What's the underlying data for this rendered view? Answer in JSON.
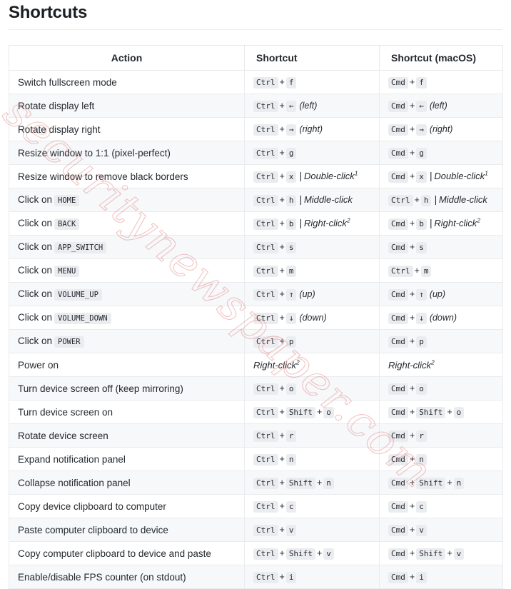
{
  "page": {
    "title": "Shortcuts",
    "watermark": "securitynewspaper.com",
    "watermark_color": "#e28282",
    "kbd_background": "#eaecef",
    "row_alt_background": "#f6f8fa",
    "border_color": "#e6e8eb"
  },
  "table": {
    "headers": {
      "action": "Action",
      "shortcut": "Shortcut",
      "shortcut_macos": "Shortcut (macOS)"
    },
    "rows": [
      {
        "action": "Switch fullscreen mode",
        "action_code": "",
        "shortcut": {
          "keys": [
            "Ctrl",
            "f"
          ],
          "alt": "",
          "alt_sup": "",
          "note": ""
        },
        "macos": {
          "keys": [
            "Cmd",
            "f"
          ],
          "alt": "",
          "alt_sup": "",
          "note": ""
        }
      },
      {
        "action": "Rotate display left",
        "action_code": "",
        "shortcut": {
          "keys": [
            "Ctrl",
            "←"
          ],
          "alt": "",
          "alt_sup": "",
          "note": "(left)"
        },
        "macos": {
          "keys": [
            "Cmd",
            "←"
          ],
          "alt": "",
          "alt_sup": "",
          "note": "(left)"
        }
      },
      {
        "action": "Rotate display right",
        "action_code": "",
        "shortcut": {
          "keys": [
            "Ctrl",
            "→"
          ],
          "alt": "",
          "alt_sup": "",
          "note": "(right)"
        },
        "macos": {
          "keys": [
            "Cmd",
            "→"
          ],
          "alt": "",
          "alt_sup": "",
          "note": "(right)"
        }
      },
      {
        "action": "Resize window to 1:1 (pixel-perfect)",
        "action_code": "",
        "shortcut": {
          "keys": [
            "Ctrl",
            "g"
          ],
          "alt": "",
          "alt_sup": "",
          "note": ""
        },
        "macos": {
          "keys": [
            "Cmd",
            "g"
          ],
          "alt": "",
          "alt_sup": "",
          "note": ""
        }
      },
      {
        "action": "Resize window to remove black borders",
        "action_code": "",
        "shortcut": {
          "keys": [
            "Ctrl",
            "x"
          ],
          "alt": "Double-click",
          "alt_sup": "1",
          "note": ""
        },
        "macos": {
          "keys": [
            "Cmd",
            "x"
          ],
          "alt": "Double-click",
          "alt_sup": "1",
          "note": ""
        }
      },
      {
        "action": "Click on",
        "action_code": "HOME",
        "shortcut": {
          "keys": [
            "Ctrl",
            "h"
          ],
          "alt": "Middle-click",
          "alt_sup": "",
          "note": ""
        },
        "macos": {
          "keys": [
            "Ctrl",
            "h"
          ],
          "alt": "Middle-click",
          "alt_sup": "",
          "note": ""
        }
      },
      {
        "action": "Click on",
        "action_code": "BACK",
        "shortcut": {
          "keys": [
            "Ctrl",
            "b"
          ],
          "alt": "Right-click",
          "alt_sup": "2",
          "note": ""
        },
        "macos": {
          "keys": [
            "Cmd",
            "b"
          ],
          "alt": "Right-click",
          "alt_sup": "2",
          "note": ""
        }
      },
      {
        "action": "Click on",
        "action_code": "APP_SWITCH",
        "shortcut": {
          "keys": [
            "Ctrl",
            "s"
          ],
          "alt": "",
          "alt_sup": "",
          "note": ""
        },
        "macos": {
          "keys": [
            "Cmd",
            "s"
          ],
          "alt": "",
          "alt_sup": "",
          "note": ""
        }
      },
      {
        "action": "Click on",
        "action_code": "MENU",
        "shortcut": {
          "keys": [
            "Ctrl",
            "m"
          ],
          "alt": "",
          "alt_sup": "",
          "note": ""
        },
        "macos": {
          "keys": [
            "Ctrl",
            "m"
          ],
          "alt": "",
          "alt_sup": "",
          "note": ""
        }
      },
      {
        "action": "Click on",
        "action_code": "VOLUME_UP",
        "shortcut": {
          "keys": [
            "Ctrl",
            "↑"
          ],
          "alt": "",
          "alt_sup": "",
          "note": "(up)"
        },
        "macos": {
          "keys": [
            "Cmd",
            "↑"
          ],
          "alt": "",
          "alt_sup": "",
          "note": "(up)"
        }
      },
      {
        "action": "Click on",
        "action_code": "VOLUME_DOWN",
        "shortcut": {
          "keys": [
            "Ctrl",
            "↓"
          ],
          "alt": "",
          "alt_sup": "",
          "note": "(down)"
        },
        "macos": {
          "keys": [
            "Cmd",
            "↓"
          ],
          "alt": "",
          "alt_sup": "",
          "note": "(down)"
        }
      },
      {
        "action": "Click on",
        "action_code": "POWER",
        "shortcut": {
          "keys": [
            "Ctrl",
            "p"
          ],
          "alt": "",
          "alt_sup": "",
          "note": ""
        },
        "macos": {
          "keys": [
            "Cmd",
            "p"
          ],
          "alt": "",
          "alt_sup": "",
          "note": ""
        }
      },
      {
        "action": "Power on",
        "action_code": "",
        "shortcut": {
          "keys": [],
          "alt": "Right-click",
          "alt_sup": "2",
          "note": ""
        },
        "macos": {
          "keys": [],
          "alt": "Right-click",
          "alt_sup": "2",
          "note": ""
        }
      },
      {
        "action": "Turn device screen off (keep mirroring)",
        "action_code": "",
        "shortcut": {
          "keys": [
            "Ctrl",
            "o"
          ],
          "alt": "",
          "alt_sup": "",
          "note": ""
        },
        "macos": {
          "keys": [
            "Cmd",
            "o"
          ],
          "alt": "",
          "alt_sup": "",
          "note": ""
        }
      },
      {
        "action": "Turn device screen on",
        "action_code": "",
        "shortcut": {
          "keys": [
            "Ctrl",
            "Shift",
            "o"
          ],
          "alt": "",
          "alt_sup": "",
          "note": ""
        },
        "macos": {
          "keys": [
            "Cmd",
            "Shift",
            "o"
          ],
          "alt": "",
          "alt_sup": "",
          "note": ""
        }
      },
      {
        "action": "Rotate device screen",
        "action_code": "",
        "shortcut": {
          "keys": [
            "Ctrl",
            "r"
          ],
          "alt": "",
          "alt_sup": "",
          "note": ""
        },
        "macos": {
          "keys": [
            "Cmd",
            "r"
          ],
          "alt": "",
          "alt_sup": "",
          "note": ""
        }
      },
      {
        "action": "Expand notification panel",
        "action_code": "",
        "shortcut": {
          "keys": [
            "Ctrl",
            "n"
          ],
          "alt": "",
          "alt_sup": "",
          "note": ""
        },
        "macos": {
          "keys": [
            "Cmd",
            "n"
          ],
          "alt": "",
          "alt_sup": "",
          "note": ""
        }
      },
      {
        "action": "Collapse notification panel",
        "action_code": "",
        "shortcut": {
          "keys": [
            "Ctrl",
            "Shift",
            "n"
          ],
          "alt": "",
          "alt_sup": "",
          "note": ""
        },
        "macos": {
          "keys": [
            "Cmd",
            "Shift",
            "n"
          ],
          "alt": "",
          "alt_sup": "",
          "note": ""
        }
      },
      {
        "action": "Copy device clipboard to computer",
        "action_code": "",
        "shortcut": {
          "keys": [
            "Ctrl",
            "c"
          ],
          "alt": "",
          "alt_sup": "",
          "note": ""
        },
        "macos": {
          "keys": [
            "Cmd",
            "c"
          ],
          "alt": "",
          "alt_sup": "",
          "note": ""
        }
      },
      {
        "action": "Paste computer clipboard to device",
        "action_code": "",
        "shortcut": {
          "keys": [
            "Ctrl",
            "v"
          ],
          "alt": "",
          "alt_sup": "",
          "note": ""
        },
        "macos": {
          "keys": [
            "Cmd",
            "v"
          ],
          "alt": "",
          "alt_sup": "",
          "note": ""
        }
      },
      {
        "action": "Copy computer clipboard to device and paste",
        "action_code": "",
        "shortcut": {
          "keys": [
            "Ctrl",
            "Shift",
            "v"
          ],
          "alt": "",
          "alt_sup": "",
          "note": ""
        },
        "macos": {
          "keys": [
            "Cmd",
            "Shift",
            "v"
          ],
          "alt": "",
          "alt_sup": "",
          "note": ""
        }
      },
      {
        "action": "Enable/disable FPS counter (on stdout)",
        "action_code": "",
        "shortcut": {
          "keys": [
            "Ctrl",
            "i"
          ],
          "alt": "",
          "alt_sup": "",
          "note": ""
        },
        "macos": {
          "keys": [
            "Cmd",
            "i"
          ],
          "alt": "",
          "alt_sup": "",
          "note": ""
        }
      }
    ]
  }
}
